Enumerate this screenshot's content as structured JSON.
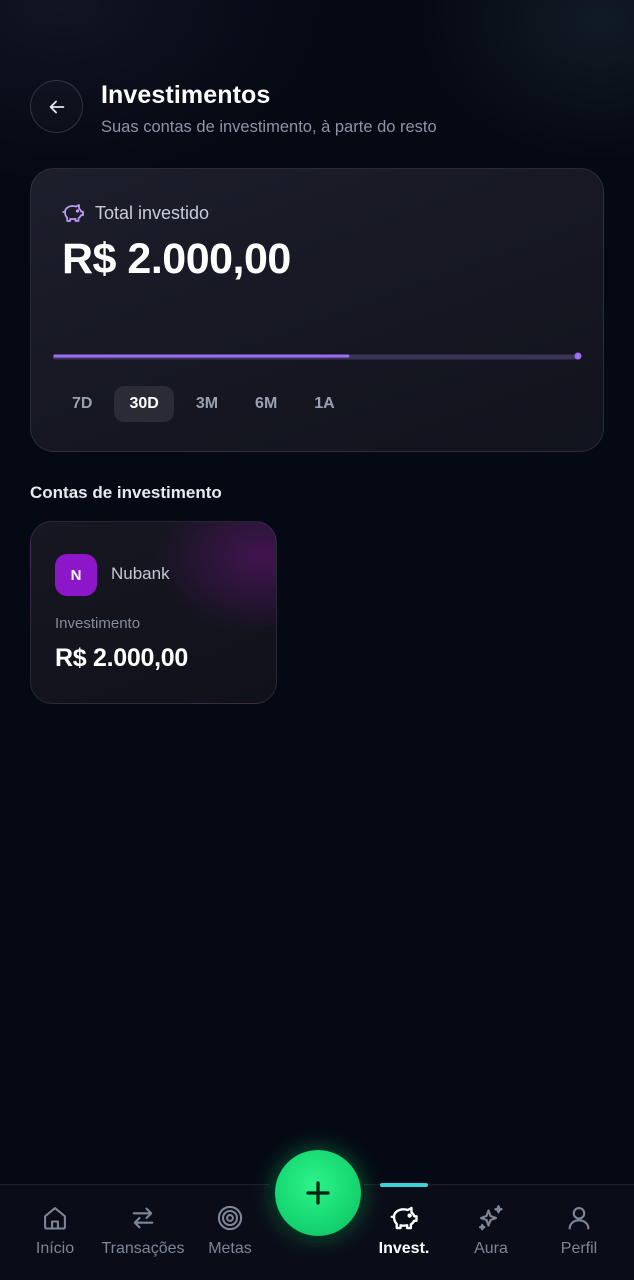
{
  "header": {
    "title": "Investimentos",
    "subtitle": "Suas contas de investimento, à parte do resto",
    "back_icon": "arrow-left-icon"
  },
  "total_card": {
    "label": "Total investido",
    "icon": "piggy-bank-icon",
    "value": "R$ 2.000,00",
    "chart_data": {
      "type": "line",
      "series": [
        {
          "values": [
            2000,
            2000
          ]
        }
      ],
      "progress_fraction": 0.56
    },
    "periods": [
      {
        "label": "7D",
        "active": false
      },
      {
        "label": "30D",
        "active": true
      },
      {
        "label": "3M",
        "active": false
      },
      {
        "label": "6M",
        "active": false
      },
      {
        "label": "1A",
        "active": false
      }
    ]
  },
  "section": {
    "title": "Contas de investimento"
  },
  "accounts": [
    {
      "badge": "N",
      "name": "Nubank",
      "type": "Investimento",
      "value": "R$ 2.000,00",
      "badge_color": "#8d16c9"
    }
  ],
  "nav": {
    "items": [
      {
        "label": "Início",
        "icon": "home-icon",
        "active": false
      },
      {
        "label": "Transações",
        "icon": "swap-arrows-icon",
        "active": false
      },
      {
        "label": "Metas",
        "icon": "target-icon",
        "active": false
      },
      {
        "label": "Invest.",
        "icon": "piggy-bank-icon",
        "active": true
      },
      {
        "label": "Aura",
        "icon": "sparkles-icon",
        "active": false
      },
      {
        "label": "Perfil",
        "icon": "user-icon",
        "active": false
      }
    ],
    "fab_icon": "plus-icon",
    "accent": "#16d670",
    "active_indicator": "#3fd1d8"
  }
}
